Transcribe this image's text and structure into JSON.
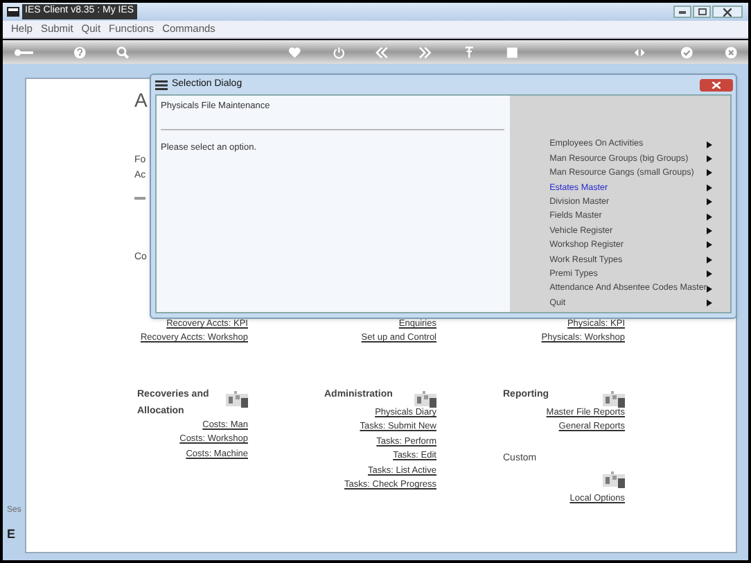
{
  "window": {
    "title": "IES Client v8.35 : My IES"
  },
  "menu": [
    "Help",
    "Submit",
    "Quit",
    "Functions",
    "Commands"
  ],
  "page": {
    "heading": "A",
    "fragments": [
      "Fo",
      "Ac",
      "Co"
    ],
    "link_row": [
      {
        "links": [
          "Recovery Accts: KPI",
          "Recovery Accts: Workshop"
        ]
      },
      {
        "links": [
          "Enquiries",
          "Set up and Control"
        ]
      },
      {
        "links": [
          "Physicals: KPI",
          "Physicals: Workshop"
        ]
      }
    ],
    "sections": [
      {
        "title": "Recoveries and Allocation",
        "links": [
          "Costs: Man",
          "Costs: Workshop",
          "Costs: Machine"
        ]
      },
      {
        "title": "Administration",
        "links": [
          "Physicals Diary",
          "Tasks: Submit New",
          "Tasks: Perform",
          "Tasks: Edit",
          "Tasks: List Active",
          "Tasks: Check Progress"
        ]
      },
      {
        "title": "Reporting",
        "links": [
          "Master File Reports",
          "General Reports"
        ],
        "sub": {
          "title": "Custom",
          "links": [
            "Local Options"
          ]
        }
      }
    ],
    "side_fragments": [
      "Ses",
      "E"
    ]
  },
  "dialog": {
    "title": "Selection Dialog",
    "subtitle": "Physicals File Maintenance",
    "prompt": "Please select an option.",
    "options": [
      {
        "label": "Employees On Activities",
        "selected": false
      },
      {
        "label": "Man Resource Groups (big Groups)",
        "selected": false
      },
      {
        "label": "Man Resource Gangs (small Groups)",
        "selected": false
      },
      {
        "label": "Estates Master",
        "selected": true
      },
      {
        "label": "Division Master",
        "selected": false
      },
      {
        "label": "Fields Master",
        "selected": false
      },
      {
        "label": "Vehicle Register",
        "selected": false
      },
      {
        "label": "Workshop Register",
        "selected": false
      },
      {
        "label": "Work Result Types",
        "selected": false
      },
      {
        "label": "Premi Types",
        "selected": false
      },
      {
        "label": "Attendance And Absentee Codes Master",
        "selected": false
      },
      {
        "label": "Quit",
        "selected": false
      }
    ]
  }
}
